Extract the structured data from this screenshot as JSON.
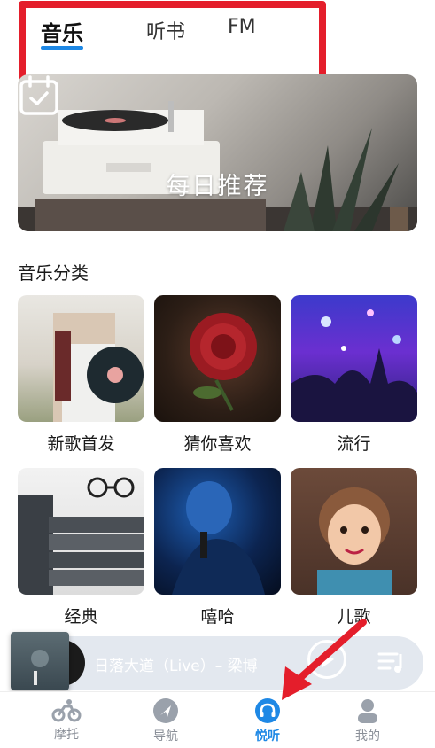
{
  "tabs": [
    {
      "label": "音乐",
      "active": true
    },
    {
      "label": "听书",
      "active": false
    },
    {
      "label": "FM",
      "active": false
    }
  ],
  "banner": {
    "title": "每日推荐",
    "icon": "calendar-check-icon"
  },
  "section": {
    "title": "音乐分类"
  },
  "categories": [
    {
      "label": "新歌首发"
    },
    {
      "label": "猜你喜欢"
    },
    {
      "label": "流行"
    },
    {
      "label": "经典"
    },
    {
      "label": "嘻哈"
    },
    {
      "label": "儿歌"
    }
  ],
  "player": {
    "track": "日落大道（Live）– 梁博",
    "icon_play": "play-icon",
    "icon_list": "playlist-icon"
  },
  "nav": [
    {
      "label": "摩托",
      "icon": "motorbike-icon",
      "active": false
    },
    {
      "label": "导航",
      "icon": "navigation-icon",
      "active": false
    },
    {
      "label": "悦听",
      "icon": "headphones-icon",
      "active": true
    },
    {
      "label": "我的",
      "icon": "profile-icon",
      "active": false
    }
  ],
  "colors": {
    "accent": "#1e88e5",
    "annotation": "#e41e2b"
  }
}
